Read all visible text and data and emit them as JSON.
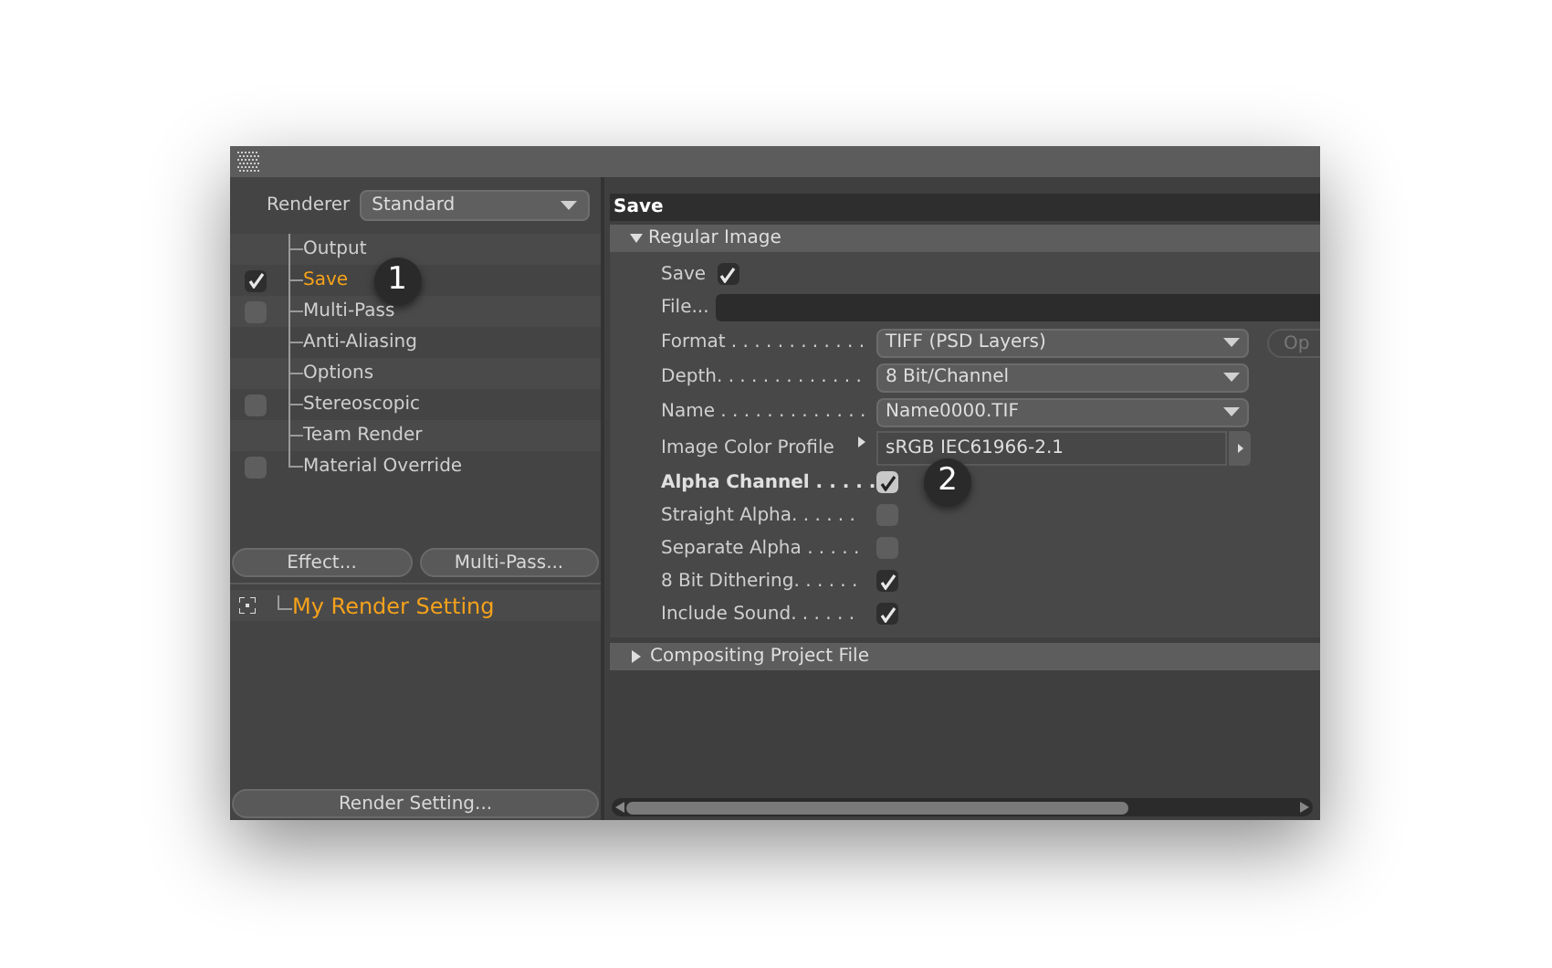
{
  "renderer": {
    "label": "Renderer",
    "value": "Standard"
  },
  "tree": [
    {
      "label": "Output",
      "kind": "plain",
      "selected": false
    },
    {
      "label": "Save",
      "kind": "checkbox",
      "checked": true,
      "selected": true,
      "callout": "1"
    },
    {
      "label": "Multi-Pass",
      "kind": "checkbox",
      "checked": false,
      "selected": false
    },
    {
      "label": "Anti-Aliasing",
      "kind": "plain",
      "selected": false
    },
    {
      "label": "Options",
      "kind": "plain",
      "selected": false
    },
    {
      "label": "Stereoscopic",
      "kind": "checkbox",
      "checked": false,
      "selected": false
    },
    {
      "label": "Team Render",
      "kind": "plain",
      "selected": false
    },
    {
      "label": "Material Override",
      "kind": "checkbox",
      "checked": false,
      "selected": false
    }
  ],
  "left_buttons": [
    "Effect...",
    "Multi-Pass..."
  ],
  "settings_list": [
    {
      "label": "My Render Setting",
      "selected": true
    }
  ],
  "bottom_button": "Render Setting...",
  "panel_title": "Save",
  "group": {
    "title": "Regular Image",
    "expanded": true
  },
  "rows": [
    {
      "kind": "checkbox",
      "label": "Save",
      "checked": true
    },
    {
      "kind": "file",
      "label": "File..."
    },
    {
      "kind": "dropdown",
      "label": "Format . . . . . . . . . . . .",
      "value": "TIFF (PSD Layers)",
      "side_button": "Op"
    },
    {
      "kind": "dropdown",
      "label": "Depth. . . . . . . . . . . . .",
      "value": "8 Bit/Channel"
    },
    {
      "kind": "dropdown",
      "label": "Name . . . . . . . . . . . . .",
      "value": "Name0000.TIF"
    },
    {
      "kind": "profile",
      "label": "Image Color Profile",
      "value": "sRGB IEC61966-2.1"
    },
    {
      "kind": "checkbox",
      "label": "Alpha Channel . . . . .",
      "checked": true,
      "bold": true,
      "highlighted": true,
      "callout": "2"
    },
    {
      "kind": "checkbox",
      "label": "Straight Alpha. . . . . .",
      "checked": false
    },
    {
      "kind": "checkbox",
      "label": "Separate Alpha . . . . .",
      "checked": false
    },
    {
      "kind": "checkbox",
      "label": "8 Bit Dithering. . . . . .",
      "checked": true
    },
    {
      "kind": "checkbox",
      "label": "Include Sound. . . . . .",
      "checked": true
    }
  ],
  "group2": {
    "title": "Compositing Project File",
    "expanded": false
  }
}
